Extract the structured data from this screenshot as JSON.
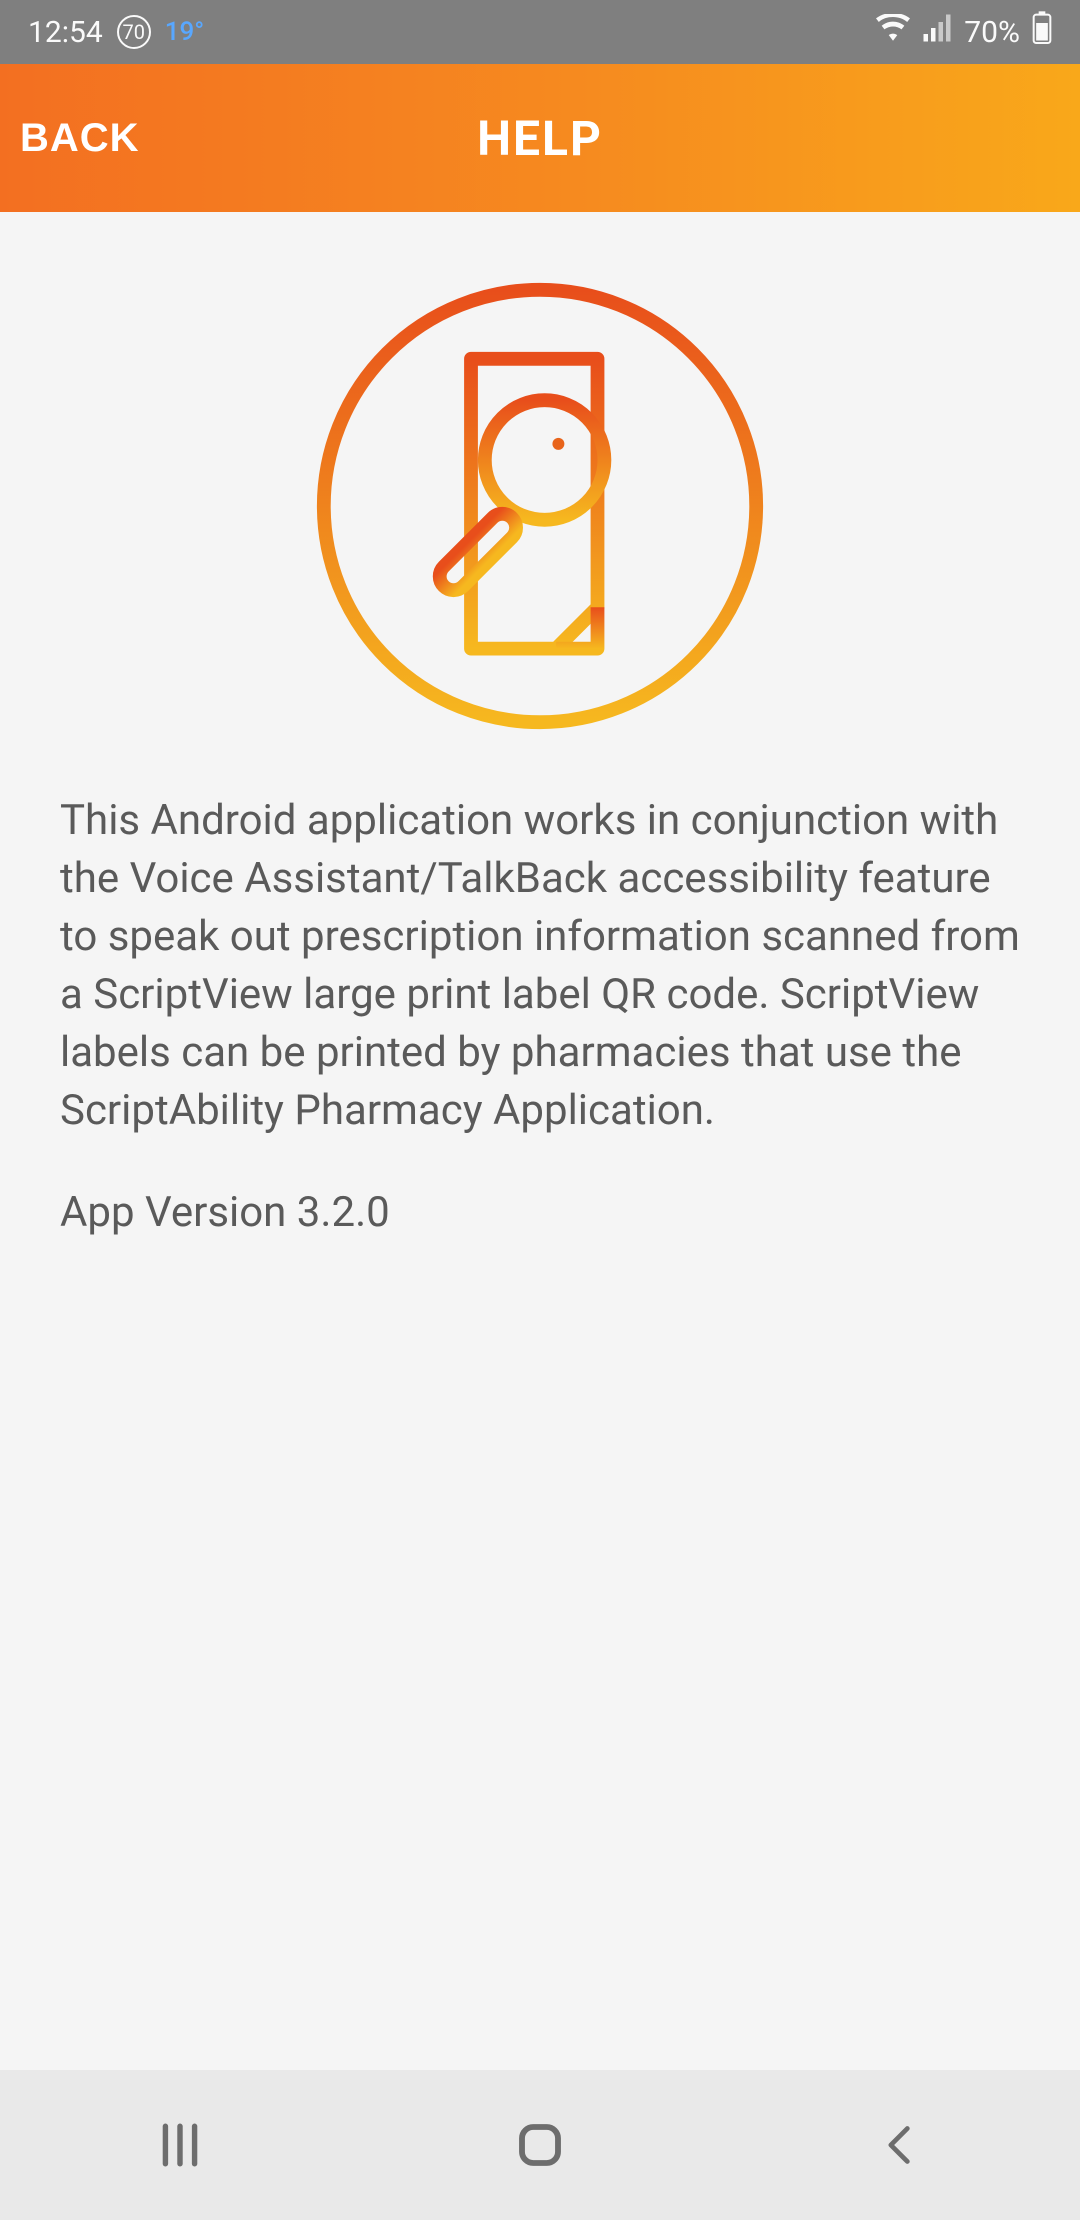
{
  "status_bar": {
    "time": "12:54",
    "badge": "70",
    "temperature": "19°",
    "battery_percent": "70%"
  },
  "header": {
    "back_label": "BACK",
    "title": "HELP"
  },
  "content": {
    "description": "This Android application works in conjunction with the Voice Assistant/TalkBack accessibility feature to speak out prescription information scanned from a ScriptView large print label QR code. ScriptView labels can be printed by pharmacies that use the ScriptAbility Pharmacy Application.",
    "version_line": "App Version 3.2.0"
  }
}
